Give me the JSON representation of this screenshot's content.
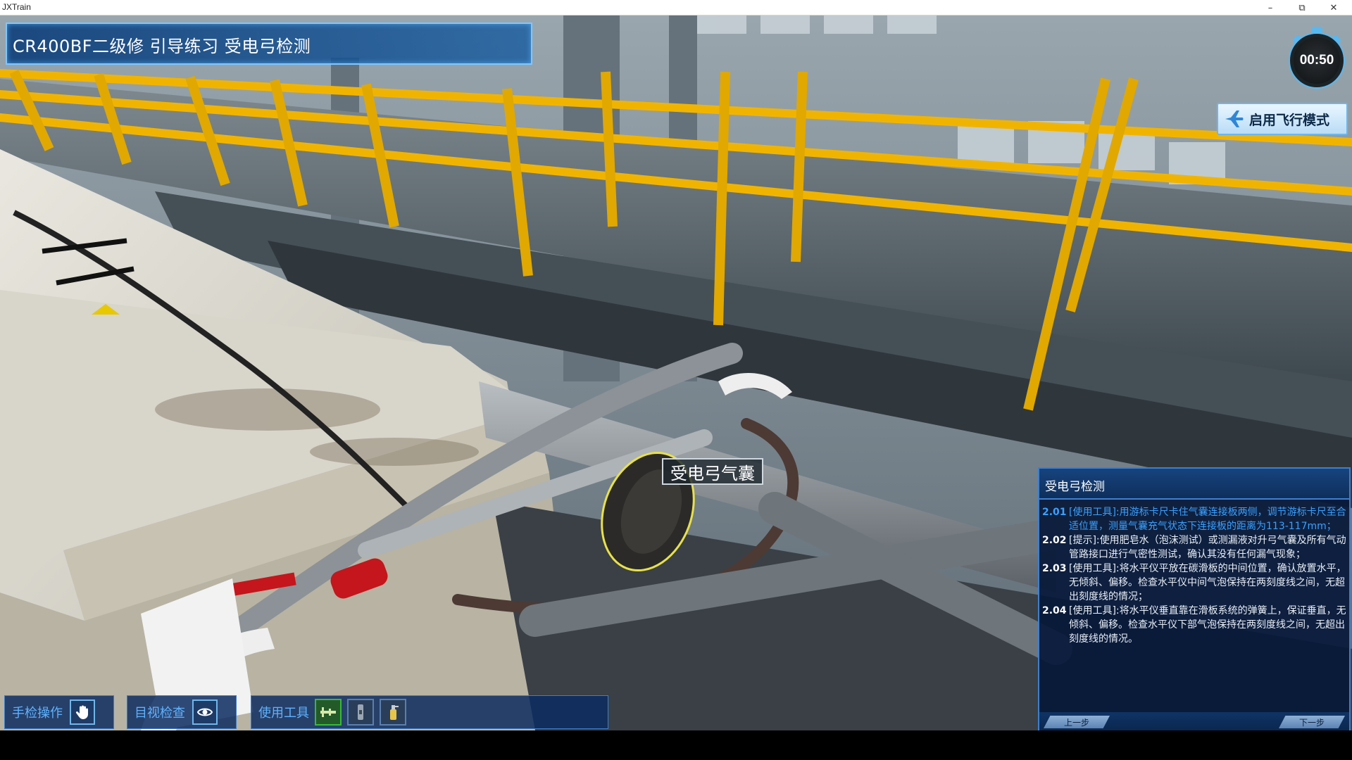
{
  "window": {
    "app_title": "JXTrain",
    "minimize": "–",
    "maximize": "⧉",
    "close": "✕"
  },
  "banner": {
    "title": "CR400BF二级修 引导练习  受电弓检测"
  },
  "timer": {
    "value": "00:50"
  },
  "flight_mode": {
    "label": "启用飞行模式",
    "icon": "airplane-icon"
  },
  "callout": {
    "label": "受电弓气囊"
  },
  "panel": {
    "title": "受电弓检测",
    "steps": [
      {
        "num": "2.01",
        "text": "[使用工具]:用游标卡尺卡住气囊连接板两侧，调节游标卡尺至合适位置，测量气囊充气状态下连接板的距离为113-117mm；",
        "active": true
      },
      {
        "num": "2.02",
        "text": "[提示]:使用肥皂水（泡沫测试）或测漏液对升弓气囊及所有气动管路接口进行气密性测试，确认其没有任何漏气现象；",
        "active": false
      },
      {
        "num": "2.03",
        "text": "[使用工具]:将水平仪平放在碳滑板的中间位置，确认放置水平，无倾斜、偏移。检查水平仪中间气泡保持在两刻度线之间，无超出刻度线的情况；",
        "active": false
      },
      {
        "num": "2.04",
        "text": "[使用工具]:将水平仪垂直靠在滑板系统的弹簧上，保证垂直，无倾斜、偏移。检查水平仪下部气泡保持在两刻度线之间，无超出刻度线的情况。",
        "active": false
      }
    ],
    "prev": "上一步",
    "next": "下一步"
  },
  "toolbar": {
    "hand": {
      "label": "手检操作",
      "icon": "hand-icon"
    },
    "visual": {
      "label": "目视检查",
      "icon": "eye-icon"
    },
    "tools": {
      "label": "使用工具",
      "items": [
        {
          "icon": "caliper-icon",
          "selected": true
        },
        {
          "icon": "level-gauge-icon",
          "selected": false
        },
        {
          "icon": "spray-bottle-icon",
          "selected": false
        }
      ]
    }
  },
  "colors": {
    "accent": "#3aa0ff",
    "panel_bg": "#061a3a",
    "railing": "#f0b400"
  }
}
